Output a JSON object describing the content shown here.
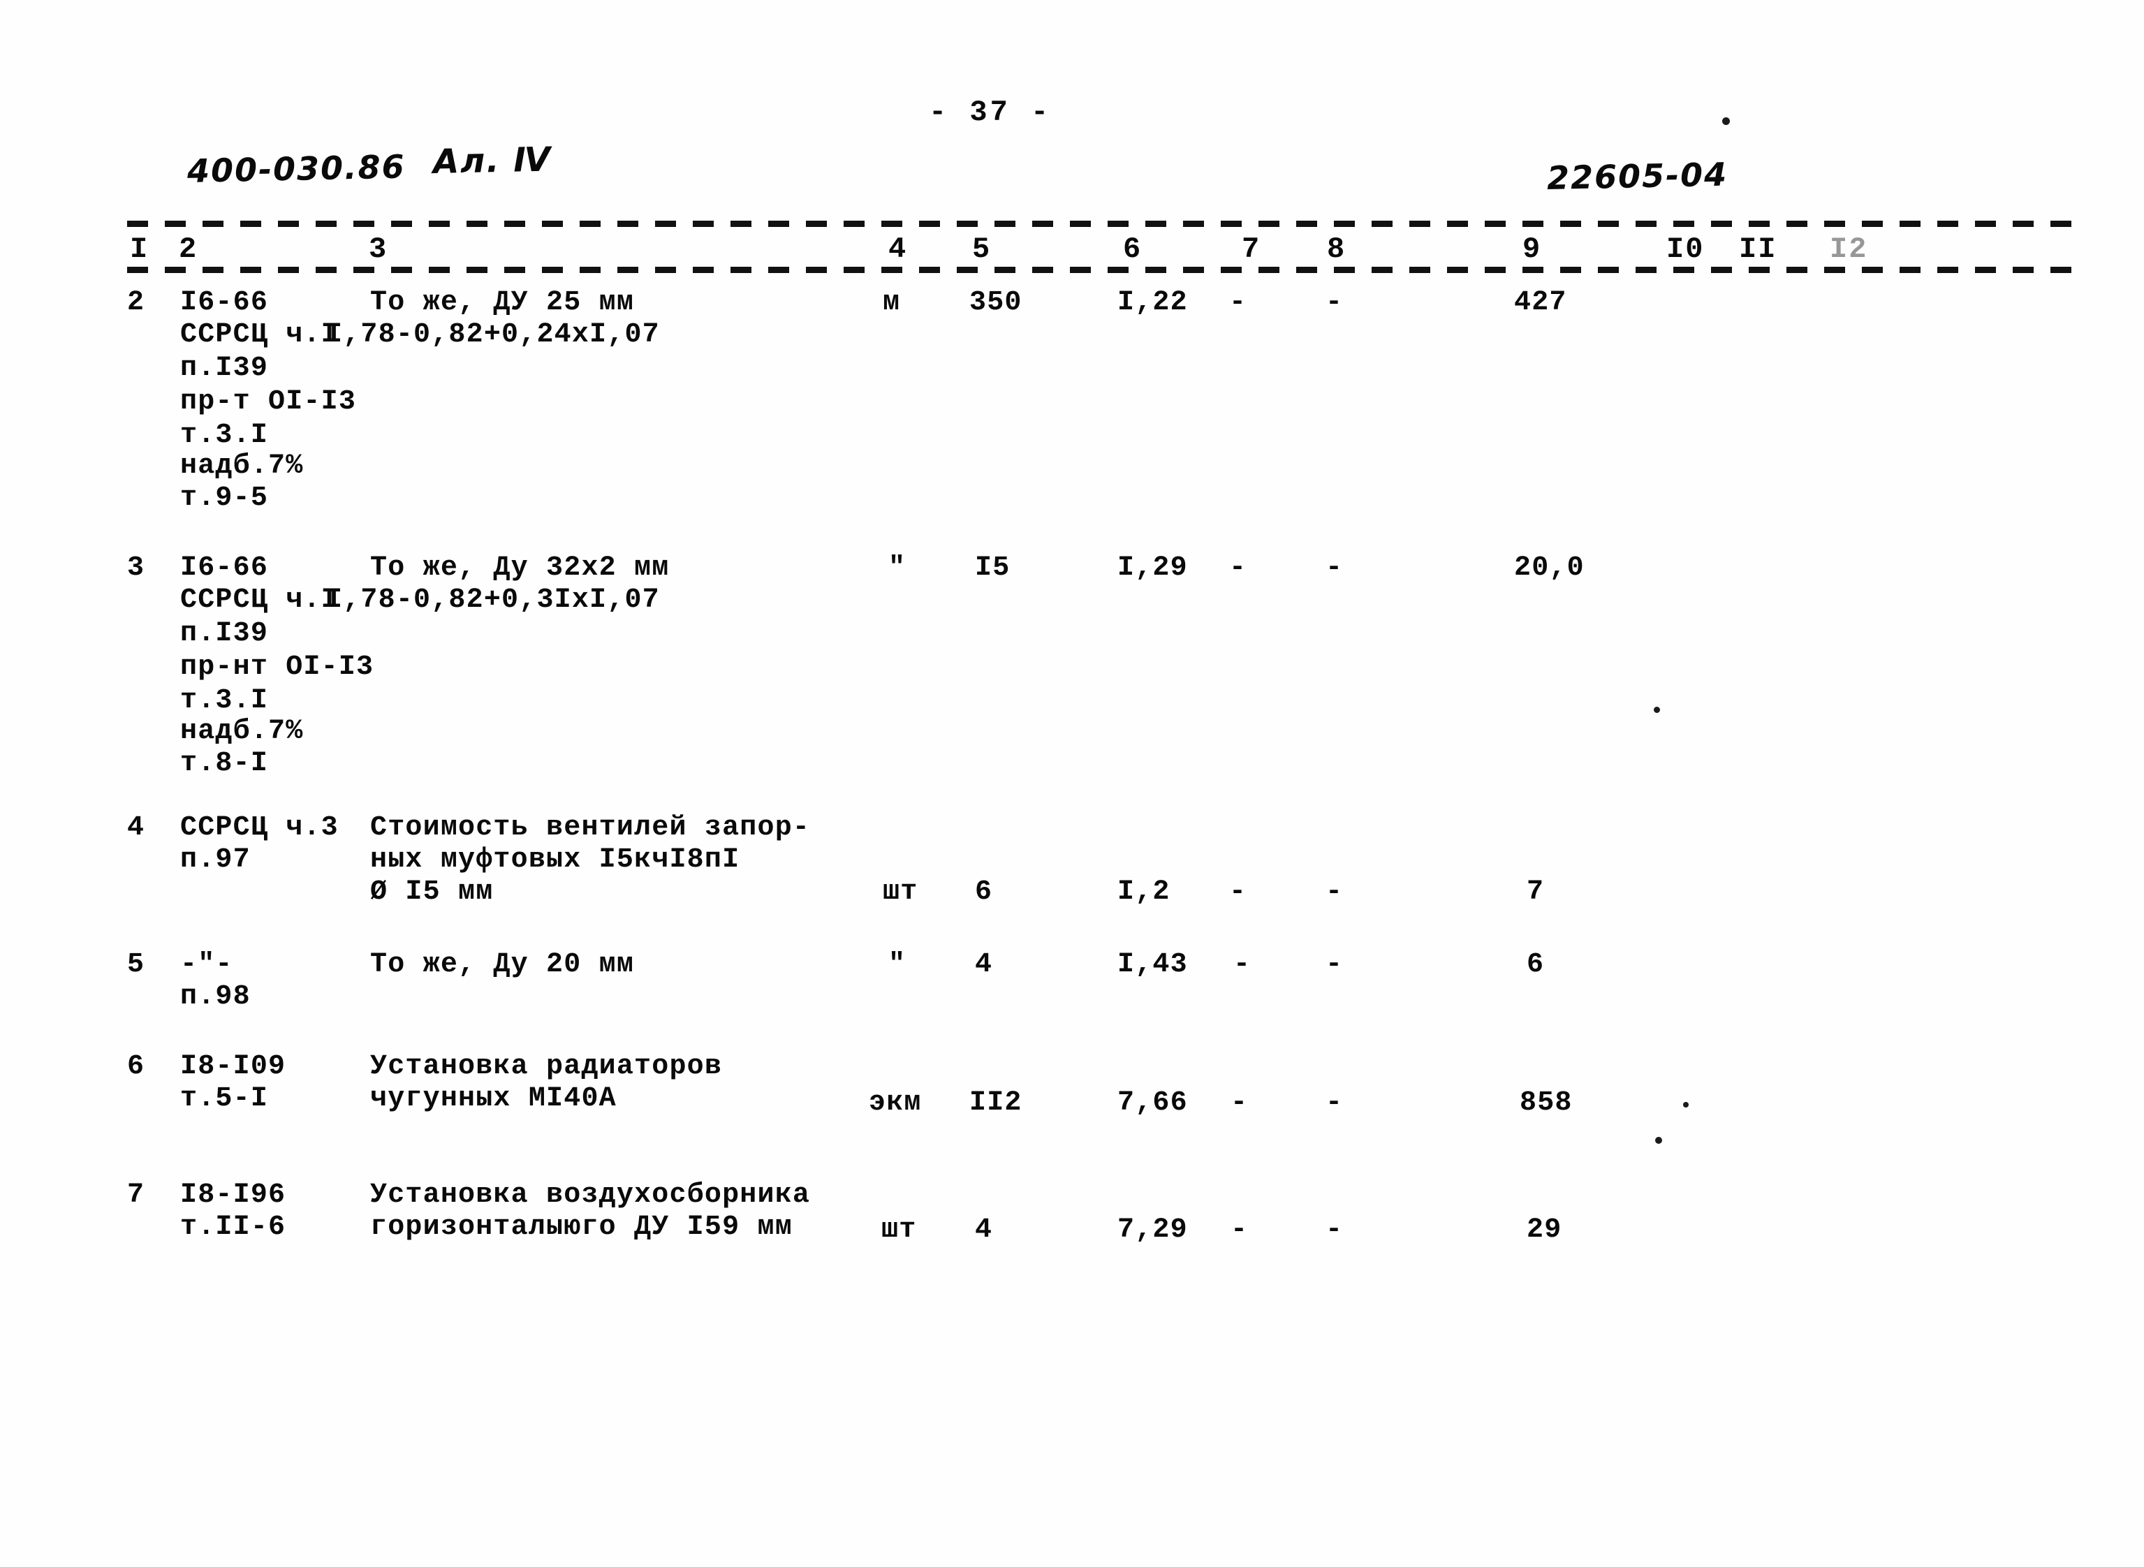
{
  "page": {
    "page_number_label": "- 37 -",
    "doc_code_handwritten": "400-030.86",
    "album_handwritten": "Ал. Ⅳ",
    "order_number_handwritten": "22605-04"
  },
  "table": {
    "column_headers": [
      "I",
      "2",
      "3",
      "4",
      "5",
      "6",
      "7",
      "8",
      "9",
      "I0",
      "II",
      "I2"
    ],
    "rows": [
      {
        "no": "2",
        "code_lines": [
          "I6-66",
          "ССРСЦ ч.I",
          "п.I39",
          "пр-т OI-I3",
          "т.3.I",
          "надб.7%",
          "т.9-5"
        ],
        "desc_lines": [
          "То же, ДУ 25 мм",
          "I,78-0,82+0,24xI,07"
        ],
        "unit": "м",
        "qty": "350",
        "c6": "I,22",
        "c7": "-",
        "c8": "-",
        "c9": "427"
      },
      {
        "no": "3",
        "code_lines": [
          "I6-66",
          "ССРСЦ ч.I",
          "п.I39",
          "пр-нт OI-I3",
          "т.3.I",
          "надб.7%",
          "т.8-I"
        ],
        "desc_lines": [
          "То же, Ду 32x2 мм",
          "I,78-0,82+0,3IxI,07"
        ],
        "unit": "\"",
        "qty": "I5",
        "c6": "I,29",
        "c7": "-",
        "c8": "-",
        "c9": "20,0"
      },
      {
        "no": "4",
        "code_lines": [
          "ССРСЦ ч.3",
          "п.97"
        ],
        "desc_lines": [
          "Стоимость вентилей запор-",
          "ных муфтовых I5кчI8пI",
          "Ø I5 мм"
        ],
        "unit": "шт",
        "qty": "6",
        "c6": "I,2",
        "c7": "-",
        "c8": "-",
        "c9": "7"
      },
      {
        "no": "5",
        "code_lines": [
          "-\"-",
          "п.98"
        ],
        "desc_lines": [
          "То же, Ду 20 мм"
        ],
        "unit": "\"",
        "qty": "4",
        "c6": "I,43",
        "c7": "-",
        "c8": "-",
        "c9": "6"
      },
      {
        "no": "6",
        "code_lines": [
          "I8-I09",
          "т.5-I"
        ],
        "desc_lines": [
          "Установка радиаторов",
          "чугунных МI40А"
        ],
        "unit": "экм",
        "qty": "II2",
        "c6": "7,66",
        "c7": "-",
        "c8": "-",
        "c9": "858"
      },
      {
        "no": "7",
        "code_lines": [
          "I8-I96",
          "т.II-6"
        ],
        "desc_lines": [
          "Установка воздухосборника",
          "горизонталыюго ДУ I59 мм"
        ],
        "unit": "шт",
        "qty": "4",
        "c6": "7,29",
        "c7": "-",
        "c8": "-",
        "c9": "29"
      }
    ]
  }
}
